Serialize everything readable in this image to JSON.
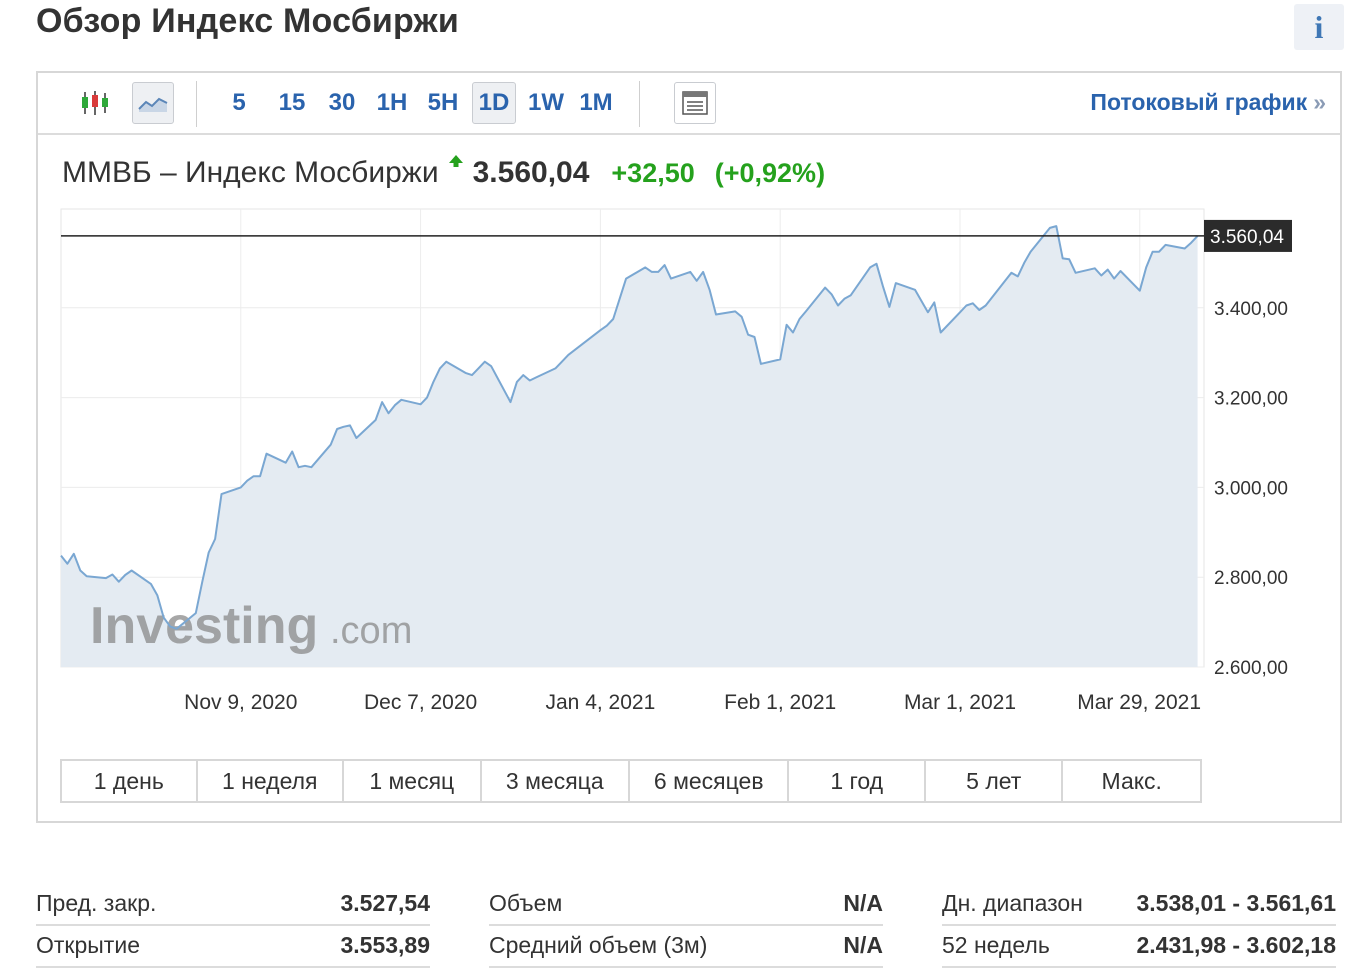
{
  "page": {
    "title": "Обзор Индекс Мосбиржи",
    "info_label": "i"
  },
  "toolbar": {
    "icons": [
      "candlestick-icon",
      "line-chart-icon",
      "table-icon"
    ],
    "timeframes": [
      "5",
      "15",
      "30",
      "1H",
      "5H",
      "1D",
      "1W",
      "1M"
    ],
    "active_timeframe": "1D",
    "stream_link": "Потоковый график",
    "stream_chevron": "»"
  },
  "quote": {
    "name": "ММВБ – Индекс Мосбиржи",
    "direction": "up",
    "price": "3.560,04",
    "change": "+32,50",
    "change_pct": "(+0,92%)",
    "up_color": "#25a11d"
  },
  "watermark": {
    "brand": "Investing",
    "suffix": ".com"
  },
  "chart_data": {
    "type": "area",
    "ylim": [
      2600,
      3620
    ],
    "y_ticks": [
      "2.600,00",
      "2.800,00",
      "3.000,00",
      "3.200,00",
      "3.400,00"
    ],
    "y_tick_values": [
      2600,
      2800,
      3000,
      3200,
      3400
    ],
    "x_ticks": [
      {
        "date": "2020-11-09",
        "label": "Nov 9, 2020"
      },
      {
        "date": "2020-12-07",
        "label": "Dec 7, 2020"
      },
      {
        "date": "2021-01-04",
        "label": "Jan 4, 2021"
      },
      {
        "date": "2021-02-01",
        "label": "Feb 1, 2021"
      },
      {
        "date": "2021-03-01",
        "label": "Mar 1, 2021"
      },
      {
        "date": "2021-03-29",
        "label": "Mar 29, 2021"
      }
    ],
    "x_range": [
      "2020-10-12",
      "2021-04-08"
    ],
    "last_price_label": "3.560,04",
    "last_price_value": 3560.04,
    "line_color": "#7aa7d2",
    "fill_color": "#e4ebf2",
    "series": [
      {
        "points": [
          [
            "2020-10-12",
            2848
          ],
          [
            "2020-10-13",
            2830
          ],
          [
            "2020-10-14",
            2852
          ],
          [
            "2020-10-15",
            2815
          ],
          [
            "2020-10-16",
            2802
          ],
          [
            "2020-10-19",
            2798
          ],
          [
            "2020-10-20",
            2806
          ],
          [
            "2020-10-21",
            2790
          ],
          [
            "2020-10-22",
            2805
          ],
          [
            "2020-10-23",
            2815
          ],
          [
            "2020-10-26",
            2785
          ],
          [
            "2020-10-27",
            2760
          ],
          [
            "2020-10-28",
            2710
          ],
          [
            "2020-10-29",
            2690
          ],
          [
            "2020-10-30",
            2685
          ],
          [
            "2020-11-02",
            2720
          ],
          [
            "2020-11-03",
            2790
          ],
          [
            "2020-11-04",
            2855
          ],
          [
            "2020-11-05",
            2885
          ],
          [
            "2020-11-06",
            2985
          ],
          [
            "2020-11-09",
            3000
          ],
          [
            "2020-11-10",
            3015
          ],
          [
            "2020-11-11",
            3025
          ],
          [
            "2020-11-12",
            3025
          ],
          [
            "2020-11-13",
            3075
          ],
          [
            "2020-11-16",
            3055
          ],
          [
            "2020-11-17",
            3080
          ],
          [
            "2020-11-18",
            3045
          ],
          [
            "2020-11-19",
            3048
          ],
          [
            "2020-11-20",
            3045
          ],
          [
            "2020-11-23",
            3095
          ],
          [
            "2020-11-24",
            3130
          ],
          [
            "2020-11-25",
            3135
          ],
          [
            "2020-11-26",
            3138
          ],
          [
            "2020-11-27",
            3110
          ],
          [
            "2020-11-30",
            3150
          ],
          [
            "2020-12-01",
            3190
          ],
          [
            "2020-12-02",
            3165
          ],
          [
            "2020-12-03",
            3183
          ],
          [
            "2020-12-04",
            3195
          ],
          [
            "2020-12-07",
            3185
          ],
          [
            "2020-12-08",
            3200
          ],
          [
            "2020-12-09",
            3235
          ],
          [
            "2020-12-10",
            3265
          ],
          [
            "2020-12-11",
            3280
          ],
          [
            "2020-12-14",
            3255
          ],
          [
            "2020-12-15",
            3250
          ],
          [
            "2020-12-16",
            3265
          ],
          [
            "2020-12-17",
            3280
          ],
          [
            "2020-12-18",
            3270
          ],
          [
            "2020-12-21",
            3190
          ],
          [
            "2020-12-22",
            3235
          ],
          [
            "2020-12-23",
            3250
          ],
          [
            "2020-12-24",
            3238
          ],
          [
            "2020-12-25",
            3245
          ],
          [
            "2020-12-28",
            3265
          ],
          [
            "2020-12-29",
            3280
          ],
          [
            "2020-12-30",
            3295
          ],
          [
            "2021-01-04",
            3350
          ],
          [
            "2021-01-05",
            3360
          ],
          [
            "2021-01-06",
            3375
          ],
          [
            "2021-01-08",
            3465
          ],
          [
            "2021-01-11",
            3490
          ],
          [
            "2021-01-12",
            3480
          ],
          [
            "2021-01-13",
            3480
          ],
          [
            "2021-01-14",
            3495
          ],
          [
            "2021-01-15",
            3465
          ],
          [
            "2021-01-18",
            3480
          ],
          [
            "2021-01-19",
            3460
          ],
          [
            "2021-01-20",
            3480
          ],
          [
            "2021-01-21",
            3440
          ],
          [
            "2021-01-22",
            3385
          ],
          [
            "2021-01-25",
            3392
          ],
          [
            "2021-01-26",
            3380
          ],
          [
            "2021-01-27",
            3340
          ],
          [
            "2021-01-28",
            3335
          ],
          [
            "2021-01-29",
            3275
          ],
          [
            "2021-02-01",
            3285
          ],
          [
            "2021-02-02",
            3362
          ],
          [
            "2021-02-03",
            3345
          ],
          [
            "2021-02-04",
            3375
          ],
          [
            "2021-02-05",
            3392
          ],
          [
            "2021-02-08",
            3445
          ],
          [
            "2021-02-09",
            3430
          ],
          [
            "2021-02-10",
            3405
          ],
          [
            "2021-02-11",
            3420
          ],
          [
            "2021-02-12",
            3428
          ],
          [
            "2021-02-15",
            3490
          ],
          [
            "2021-02-16",
            3498
          ],
          [
            "2021-02-17",
            3448
          ],
          [
            "2021-02-18",
            3402
          ],
          [
            "2021-02-19",
            3455
          ],
          [
            "2021-02-22",
            3440
          ],
          [
            "2021-02-24",
            3390
          ],
          [
            "2021-02-25",
            3412
          ],
          [
            "2021-02-26",
            3345
          ],
          [
            "2021-03-01",
            3390
          ],
          [
            "2021-03-02",
            3405
          ],
          [
            "2021-03-03",
            3410
          ],
          [
            "2021-03-04",
            3395
          ],
          [
            "2021-03-05",
            3405
          ],
          [
            "2021-03-09",
            3478
          ],
          [
            "2021-03-10",
            3470
          ],
          [
            "2021-03-11",
            3500
          ],
          [
            "2021-03-12",
            3525
          ],
          [
            "2021-03-15",
            3578
          ],
          [
            "2021-03-16",
            3582
          ],
          [
            "2021-03-17",
            3510
          ],
          [
            "2021-03-18",
            3508
          ],
          [
            "2021-03-19",
            3478
          ],
          [
            "2021-03-22",
            3488
          ],
          [
            "2021-03-23",
            3472
          ],
          [
            "2021-03-24",
            3485
          ],
          [
            "2021-03-25",
            3465
          ],
          [
            "2021-03-26",
            3482
          ],
          [
            "2021-03-29",
            3438
          ],
          [
            "2021-03-30",
            3490
          ],
          [
            "2021-03-31",
            3525
          ],
          [
            "2021-04-01",
            3525
          ],
          [
            "2021-04-02",
            3540
          ],
          [
            "2021-04-05",
            3532
          ],
          [
            "2021-04-06",
            3545
          ],
          [
            "2021-04-07",
            3560
          ]
        ]
      }
    ]
  },
  "ranges": [
    "1 день",
    "1 неделя",
    "1 месяц",
    "3 месяца",
    "6 месяцев",
    "1 год",
    "5 лет",
    "Макс."
  ],
  "stats": {
    "col1": [
      {
        "label": "Пред. закр.",
        "value": "3.527,54"
      },
      {
        "label": "Открытие",
        "value": "3.553,89"
      }
    ],
    "col2": [
      {
        "label": "Объем",
        "value": "N/A"
      },
      {
        "label": "Средний объем (3м)",
        "value": "N/A"
      }
    ],
    "col3": [
      {
        "label": "Дн. диапазон",
        "value": "3.538,01 - 3.561,61"
      },
      {
        "label": "52 недель",
        "value": "2.431,98 - 3.602,18"
      }
    ]
  }
}
